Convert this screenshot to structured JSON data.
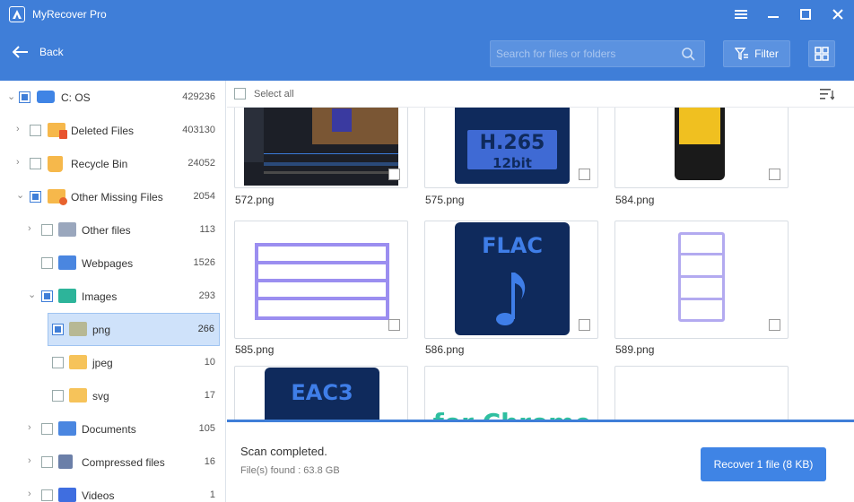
{
  "app": {
    "title": "MyRecover Pro"
  },
  "header": {
    "back_label": "Back",
    "search_placeholder": "Search for files or folders",
    "filter_label": "Filter"
  },
  "sidebar": {
    "items": [
      {
        "label": "C: OS",
        "count": "429236"
      },
      {
        "label": "Deleted Files",
        "count": "403130"
      },
      {
        "label": "Recycle Bin",
        "count": "24052"
      },
      {
        "label": "Other Missing Files",
        "count": "2054"
      },
      {
        "label": "Other files",
        "count": "113"
      },
      {
        "label": "Webpages",
        "count": "1526"
      },
      {
        "label": "Images",
        "count": "293"
      },
      {
        "label": "png",
        "count": "266"
      },
      {
        "label": "jpeg",
        "count": "10"
      },
      {
        "label": "svg",
        "count": "17"
      },
      {
        "label": "Documents",
        "count": "105"
      },
      {
        "label": "Compressed files",
        "count": "16"
      },
      {
        "label": "Videos",
        "count": "1"
      }
    ]
  },
  "main": {
    "select_all_label": "Select all",
    "files": [
      {
        "name": "572.png"
      },
      {
        "name": "575.png",
        "thumb_line1": "H.265",
        "thumb_line2": "12bit"
      },
      {
        "name": "584.png"
      },
      {
        "name": "585.png"
      },
      {
        "name": "586.png",
        "thumb_text": "FLAC"
      },
      {
        "name": "589.png"
      },
      {
        "name": "",
        "thumb_text": "EAC3"
      },
      {
        "name": "",
        "thumb_text": "for Chrome"
      },
      {
        "name": ""
      }
    ]
  },
  "footer": {
    "status": "Scan completed.",
    "found": "File(s) found : 63.8 GB",
    "recover_label": "Recover 1 file (8 KB)"
  },
  "colors": {
    "accent": "#3f7ed8",
    "selected_row": "#cfe2fa"
  }
}
